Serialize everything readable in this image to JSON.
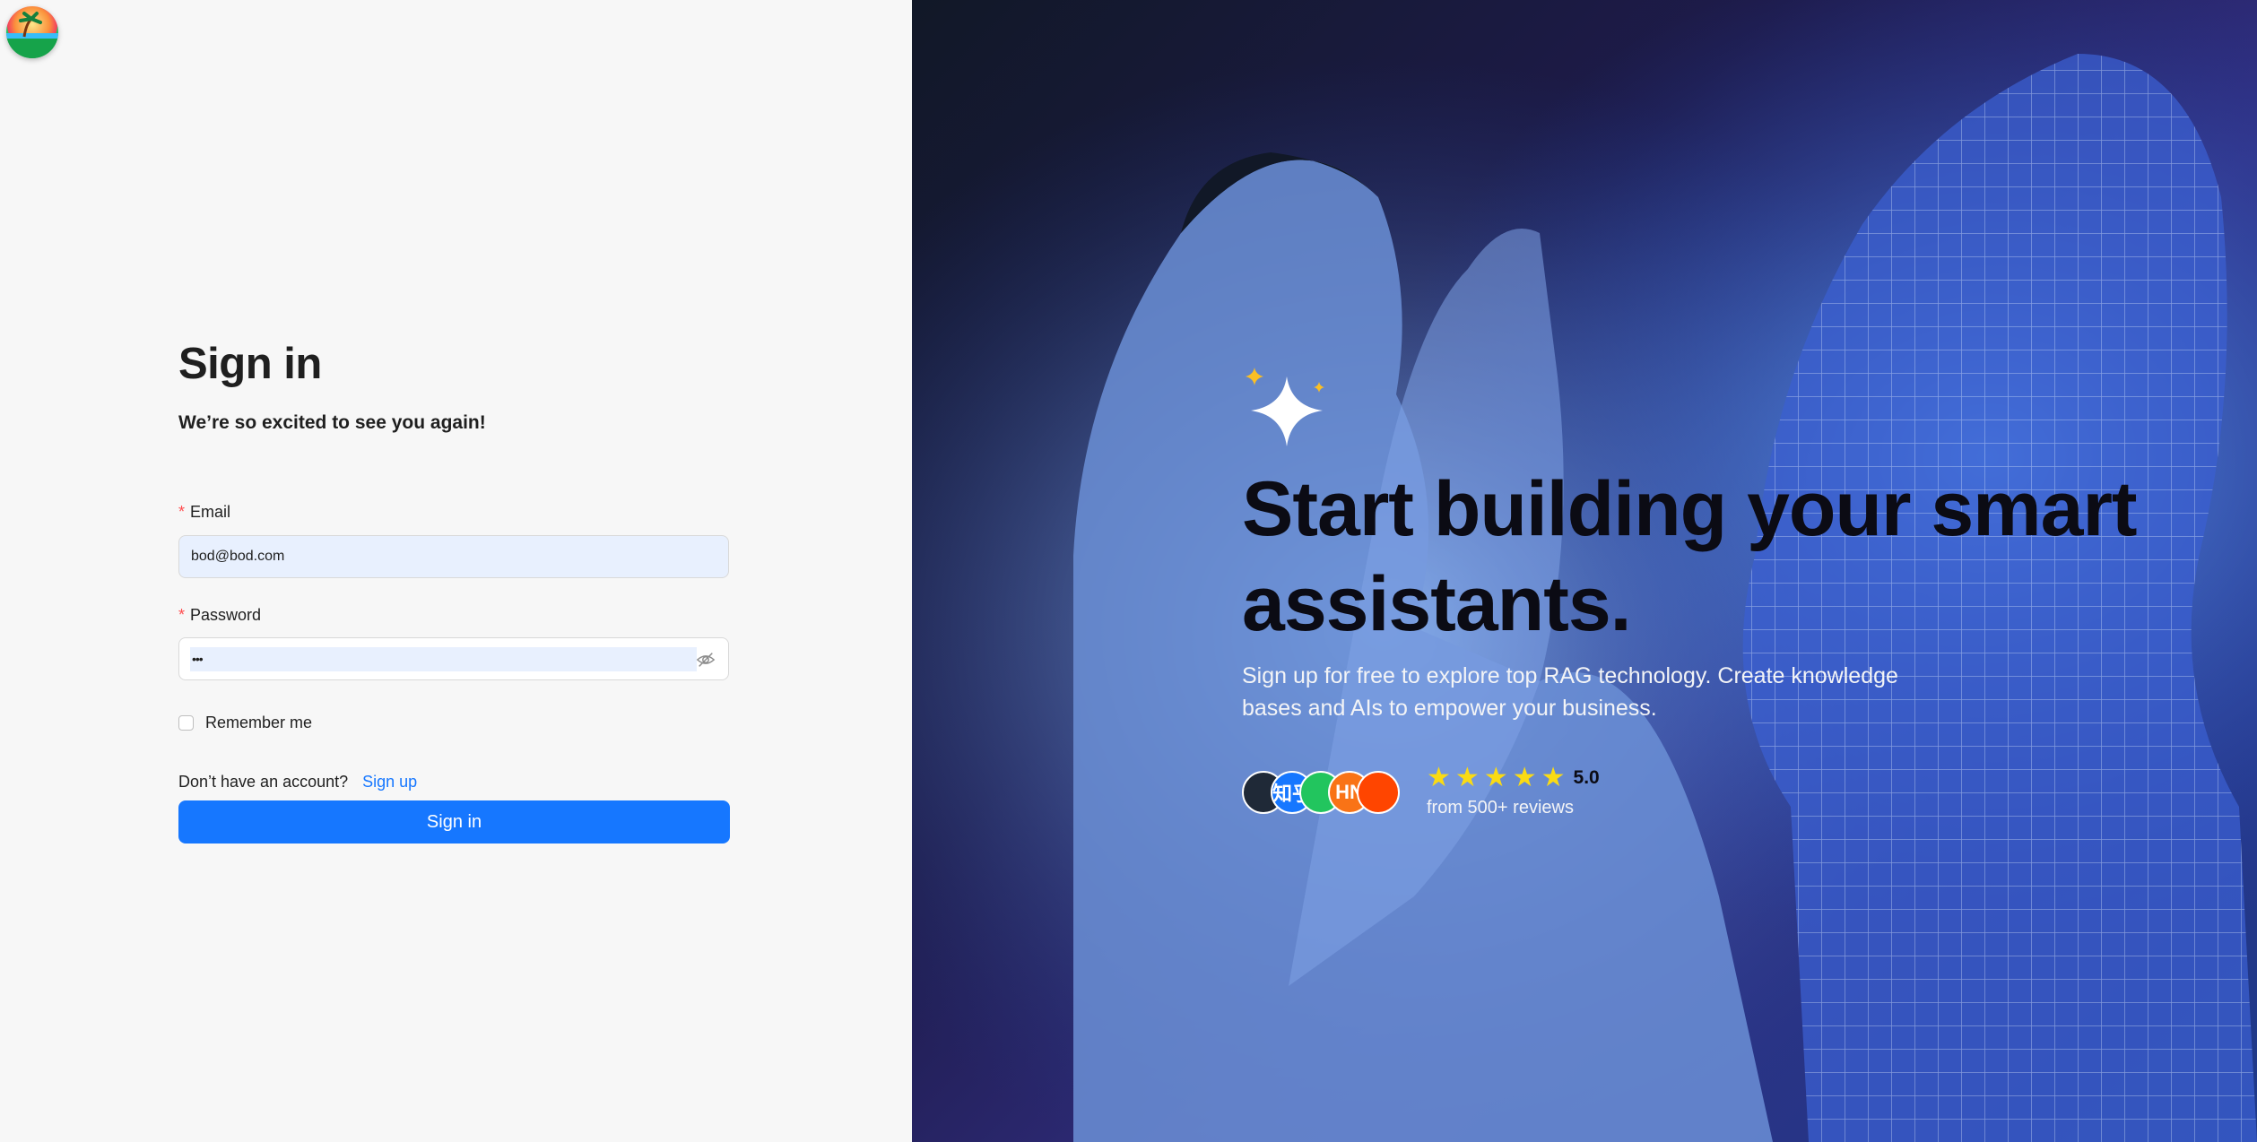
{
  "logo": {
    "icon": "island-sunset-logo-icon"
  },
  "signin": {
    "title": "Sign in",
    "subtitle": "We’re so excited to see you again!",
    "email_label": "Email",
    "email_value": "bod@bod.com",
    "password_label": "Password",
    "password_value": "•••",
    "required_mark": "*",
    "remember_label": "Remember me",
    "no_account_text": "Don’t have an account?",
    "signup_link": "Sign up",
    "button_label": "Sign in",
    "primary_color": "#1677ff"
  },
  "promo": {
    "headline": "Start building your smart assistants.",
    "description": "Sign up for free to explore top RAG technology. Create knowledge bases and AIs to empower your business.",
    "avatars": [
      {
        "name": "github-avatar",
        "text": "",
        "color": "#1f2937"
      },
      {
        "name": "zhihu-avatar",
        "text": "知乎",
        "color": "#1677ff"
      },
      {
        "name": "wechat-avatar",
        "text": "",
        "color": "#22c55e"
      },
      {
        "name": "hackernews-avatar",
        "text": "HN",
        "color": "#f97316"
      },
      {
        "name": "reddit-avatar",
        "text": "",
        "color": "#ff4500"
      }
    ],
    "rating": "5.0",
    "stars": 5,
    "reviews": "from 500+ reviews"
  }
}
